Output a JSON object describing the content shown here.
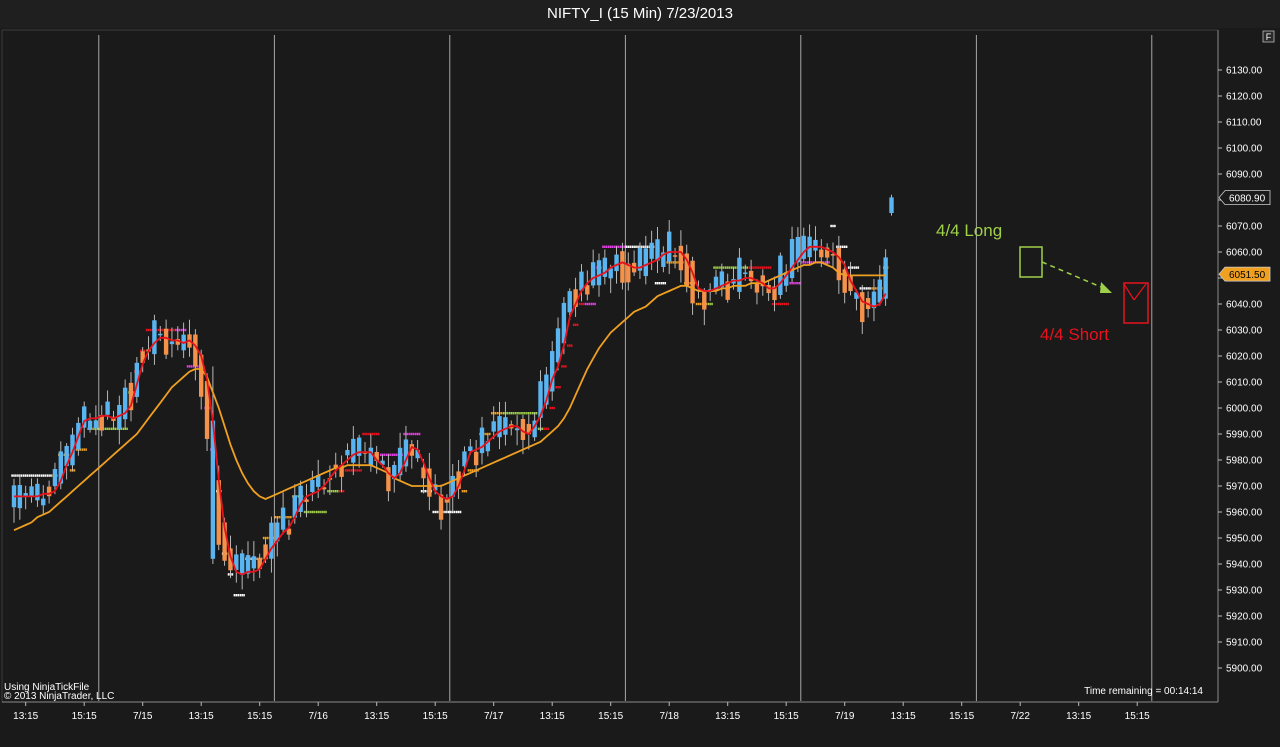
{
  "window": {
    "title": "NIFTY_I (15 Min)  7/23/2013",
    "corner_button": "F"
  },
  "colors": {
    "background": "#1a1a1a",
    "bull_candle": "#5ab4f0",
    "bear_candle": "#f4914a",
    "fast_ma": "#e8121c",
    "slow_ma": "#f0a020",
    "long_annotation": "#9fd04a",
    "short_annotation": "#e8121c"
  },
  "annotations": {
    "long_label": "4/4 Long",
    "short_label": "4/4 Short"
  },
  "footer": {
    "tickfile": "Using NinjaTickFile",
    "copyright": "© 2013 NinjaTrader, LLC",
    "time_remaining": "Time remaining = 00:14:14"
  },
  "chart_data": {
    "type": "candlestick",
    "title": "NIFTY_I (15 Min)  7/23/2013",
    "y_axis": {
      "position": "right",
      "range": [
        5896,
        6140
      ],
      "ticks": [
        5900,
        5910,
        5920,
        5930,
        5940,
        5950,
        5960,
        5970,
        5980,
        5990,
        6000,
        6010,
        6020,
        6030,
        6040,
        6050,
        6060,
        6070,
        6080,
        6090,
        6100,
        6110,
        6120,
        6130
      ],
      "tick_labels": [
        "5900.00",
        "5910.00",
        "5920.00",
        "5930.00",
        "5940.00",
        "5950.00",
        "5960.00",
        "5970.00",
        "5980.00",
        "5990.00",
        "6000.00",
        "6010.00",
        "6020.00",
        "6030.00",
        "6040.00",
        "6050.00",
        "6060.00",
        "6070.00",
        "6080.00",
        "6090.00",
        "6100.00",
        "6110.00",
        "6120.00",
        "6130.00"
      ]
    },
    "x_axis": {
      "tick_labels": [
        "13:15",
        "15:15",
        "7/15",
        "13:15",
        "15:15",
        "7/16",
        "13:15",
        "15:15",
        "7/17",
        "13:15",
        "15:15",
        "7/18",
        "13:15",
        "15:15",
        "7/19",
        "13:15",
        "15:15",
        "7/22",
        "13:15",
        "15:15"
      ],
      "tick_bar_index": [
        2,
        12,
        22,
        32,
        42,
        52,
        62,
        72,
        82,
        92,
        102,
        112,
        122,
        132,
        142,
        152,
        162,
        172,
        182,
        192
      ]
    },
    "session_breaks_bar_index": [
      14.5,
      44.5,
      74.5,
      104.5,
      134.5,
      164.5,
      194.5
    ],
    "price_markers": [
      {
        "label": "6080.90",
        "value": 6080.9,
        "style": "last"
      },
      {
        "label": "6051.50",
        "value": 6051.5,
        "style": "ma"
      }
    ],
    "fast_ma_values": [
      5966,
      5966,
      5966,
      5966,
      5966,
      5967,
      5967,
      5968,
      5972,
      5978,
      5983,
      5989,
      5995,
      5996,
      5996,
      5997,
      5997,
      5996,
      5997,
      5998,
      6001,
      6009,
      6017,
      6022,
      6025,
      6027,
      6027,
      6026,
      6026,
      6025,
      6026,
      6024,
      6020,
      6011,
      5995,
      5972,
      5954,
      5943,
      5937,
      5936,
      5937,
      5937,
      5938,
      5942,
      5946,
      5949,
      5952,
      5954,
      5958,
      5963,
      5966,
      5967,
      5968,
      5970,
      5973,
      5976,
      5978,
      5980,
      5982,
      5983,
      5983,
      5983,
      5980,
      5978,
      5975,
      5973,
      5975,
      5980,
      5985,
      5984,
      5979,
      5973,
      5968,
      5966,
      5965,
      5966,
      5970,
      5976,
      5983,
      5984,
      5985,
      5987,
      5989,
      5991,
      5992,
      5993,
      5993,
      5991,
      5990,
      5993,
      5997,
      6003,
      6011,
      6016,
      6024,
      6035,
      6040,
      6045,
      6048,
      6050,
      6051,
      6052,
      6054,
      6055,
      6056,
      6055,
      6054,
      6054,
      6055,
      6056,
      6057,
      6059,
      6060,
      6060,
      6060,
      6057,
      6052,
      6046,
      6045,
      6045,
      6046,
      6047,
      6048,
      6049,
      6049,
      6050,
      6050,
      6049,
      6048,
      6046,
      6046,
      6048,
      6051,
      6054,
      6057,
      6060,
      6062,
      6062,
      6062,
      6061,
      6060,
      6058,
      6055,
      6049,
      6045,
      6041,
      6040,
      6039,
      6040,
      6044
    ],
    "slow_ma_values": [
      5953,
      5954,
      5955,
      5956,
      5958,
      5959,
      5960,
      5962,
      5964,
      5966,
      5968,
      5970,
      5972,
      5974,
      5976,
      5978,
      5980,
      5982,
      5984,
      5986,
      5988,
      5990,
      5993,
      5996,
      5999,
      6002,
      6005,
      6008,
      6010,
      6012,
      6014,
      6015,
      6015,
      6012,
      6006,
      6000,
      5993,
      5986,
      5980,
      5975,
      5971,
      5968,
      5966,
      5965,
      5966,
      5967,
      5968,
      5969,
      5970,
      5971,
      5972,
      5973,
      5974,
      5975,
      5976,
      5977,
      5977,
      5978,
      5978,
      5978,
      5978,
      5978,
      5977,
      5976,
      5975,
      5973,
      5972,
      5971,
      5970,
      5970,
      5970,
      5970,
      5970,
      5970,
      5971,
      5972,
      5973,
      5974,
      5975,
      5976,
      5977,
      5978,
      5979,
      5980,
      5981,
      5982,
      5983,
      5984,
      5985,
      5986,
      5987,
      5989,
      5991,
      5993,
      5996,
      6000,
      6005,
      6010,
      6015,
      6019,
      6023,
      6026,
      6029,
      6031,
      6033,
      6035,
      6037,
      6038,
      6039,
      6041,
      6043,
      6044,
      6045,
      6046,
      6047,
      6047,
      6046,
      6045,
      6045,
      6045,
      6045,
      6046,
      6046,
      6047,
      6047,
      6047,
      6048,
      6048,
      6048,
      6049,
      6050,
      6051,
      6052,
      6053,
      6054,
      6055,
      6055,
      6056,
      6056,
      6055,
      6054,
      6052,
      6051,
      6051,
      6051,
      6051,
      6051,
      6051,
      6051,
      6051
    ]
  }
}
